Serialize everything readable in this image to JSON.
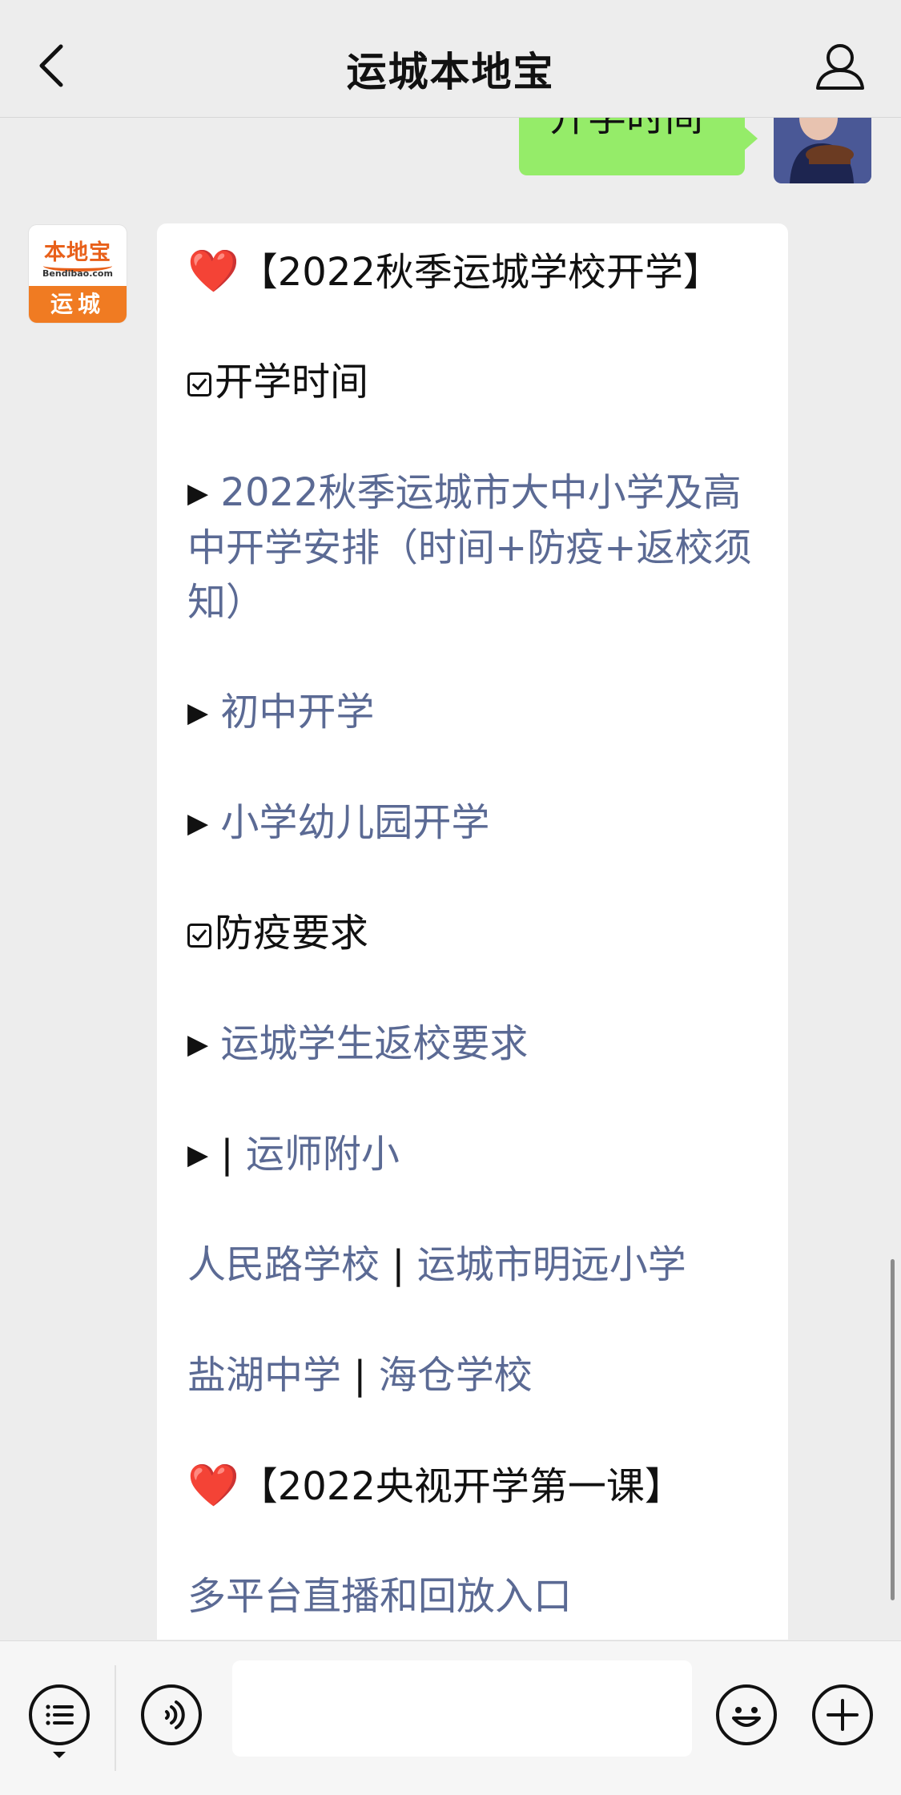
{
  "header": {
    "title": "运城本地宝",
    "back_icon": "chevron-left-icon",
    "profile_icon": "person-icon"
  },
  "outgoing": {
    "text": "开学时间"
  },
  "bot_avatar": {
    "logo_text": "本地宝",
    "logo_url": "Bendibao.com",
    "city": "运城"
  },
  "message": {
    "heading1": "【2022秋季运城学校开学】",
    "section1_title": "开学时间",
    "link1": "2022秋季运城市大中小学及高中开学安排（时间+防疫+返校须知）",
    "link2": "初中开学",
    "link3": "小学幼儿园开学",
    "section2_title": "防疫要求",
    "link4": "运城学生返校要求",
    "link5": "运师附小",
    "link6": "人民路学校",
    "link7": "运城市明远小学",
    "link8": "盐湖中学",
    "link9": "海仓学校",
    "heading2": "【2022央视开学第一课】",
    "link10": "多平台直播和回放入口",
    "separator": "|",
    "heart_emoji": "❤️",
    "bullet": "▶"
  },
  "inputbar": {
    "menu_icon": "menu-list-icon",
    "voice_icon": "voice-icon",
    "emoji_icon": "smile-icon",
    "plus_icon": "plus-icon",
    "input_value": ""
  },
  "colors": {
    "background": "#ededed",
    "outgoing_bubble": "#95ec69",
    "incoming_bubble": "#ffffff",
    "link": "#5b6a94",
    "brand_orange": "#f07b22"
  }
}
